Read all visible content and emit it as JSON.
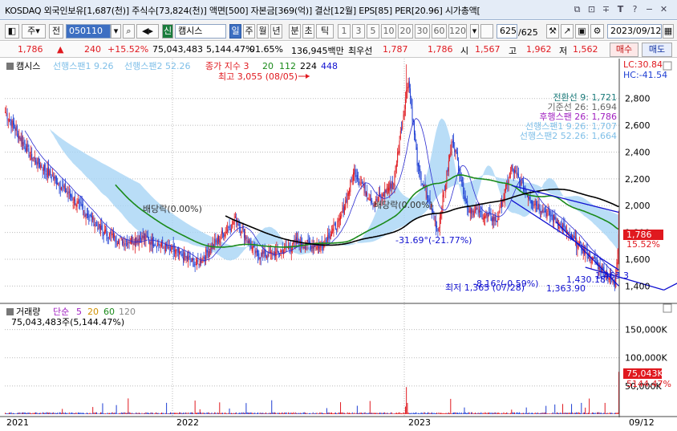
{
  "window": {
    "title": "KOSDAQ 외국인보유[1,687(천)] 주식수[73,824(천)] 액면[500] 자본금[369(억)] 결산[12월] EPS[85] PER[20.96] 시가총액["
  },
  "toolbar": {
    "code": "050110",
    "sh_badge": "신",
    "stock_name": "캠시스",
    "ju": "주",
    "jeon": "전",
    "periods": [
      "일",
      "주",
      "월",
      "년",
      "분",
      "초",
      "틱"
    ],
    "numbers": [
      "1",
      "3",
      "5",
      "10",
      "20",
      "30",
      "60",
      "120"
    ],
    "count": "625",
    "count_total": "/625",
    "date": "2023/09/12"
  },
  "quote": {
    "price": "1,786",
    "change": "240",
    "pct": "+15.52%",
    "volume": "75,043,483",
    "vol_pct": "5,144.47%",
    "turnover": "01.65%",
    "amount": "136,945백만",
    "best_ask_label": "최우선",
    "best_ask": "1,787",
    "best_bid": "1,786",
    "open_label": "시",
    "open": "1,567",
    "high_label": "고",
    "high": "1,962",
    "low_label": "저",
    "low": "1,562",
    "buy": "매수",
    "sell": "매도"
  },
  "price_panel": {
    "stock": "캠시스",
    "leg1": "선행스팬1 9.26",
    "leg2": "선행스팬2 52.26",
    "close_leg": "종가 지수 3",
    "periods": [
      "20",
      "112",
      "224",
      "448"
    ],
    "lc": "LC:30.84",
    "hc": "HC:-41.54",
    "high_note": "최고 3,055 (08/05)",
    "low_note": "최저 1,365 (07/28)",
    "low_value": "1,363.90",
    "trend_a": "1,430.18",
    "trend_b": "1,463.3",
    "angle1": "-31.69°(-21.77%)",
    "angle2": "-8.16°(-0.59%)",
    "dividend1": "배당락(0.00%)",
    "dividend2": "배당락(0.00%)",
    "ichimoku": [
      "전환선 9: 1,721",
      "기준선 26: 1,694",
      "후행스팬 26: 1,786",
      "선행스팬1 9.26: 1,707",
      "선행스팬2 52.26: 1,664"
    ],
    "price_tag": "1,786",
    "pct_tag": "15.52%"
  },
  "volume_panel": {
    "title": "거래량",
    "ma_label": "단순",
    "ma": [
      "5",
      "20",
      "60",
      "120"
    ],
    "value": "75,043,483주(5,144.47%)",
    "tag": "75,043K",
    "tag_pct": "5144.47%"
  },
  "x_axis": {
    "labels": [
      "2021",
      "2022",
      "2023",
      "09/12"
    ]
  },
  "colors": {
    "up": "#e0191f",
    "down": "#1e3fd3",
    "cloud": "#a8d4f5",
    "ma20": "#1a8a1a",
    "ma112": "#000000",
    "trend": "#1010d0"
  },
  "chart_data": {
    "type": "candlestick",
    "ylim": [
      1300,
      3050
    ],
    "yticks": [
      1400,
      1600,
      1800,
      2000,
      2200,
      2400,
      2600,
      2800
    ],
    "vol_ticks": [
      50000,
      100000,
      150000
    ],
    "vol_ylim": [
      0,
      175000
    ],
    "days": 625,
    "anchors": [
      [
        0,
        2700
      ],
      [
        25,
        2380
      ],
      [
        50,
        2200
      ],
      [
        75,
        2000
      ],
      [
        100,
        1800
      ],
      [
        120,
        1730
      ],
      [
        140,
        1760
      ],
      [
        175,
        1650
      ],
      [
        195,
        1560
      ],
      [
        215,
        1740
      ],
      [
        235,
        1900
      ],
      [
        255,
        1630
      ],
      [
        275,
        1640
      ],
      [
        295,
        1720
      ],
      [
        320,
        1700
      ],
      [
        340,
        1880
      ],
      [
        355,
        2260
      ],
      [
        375,
        2010
      ],
      [
        395,
        2180
      ],
      [
        410,
        2950
      ],
      [
        420,
        2260
      ],
      [
        440,
        1820
      ],
      [
        455,
        2500
      ],
      [
        470,
        1980
      ],
      [
        500,
        1890
      ],
      [
        515,
        2280
      ],
      [
        535,
        2040
      ],
      [
        560,
        1890
      ],
      [
        590,
        1650
      ],
      [
        620,
        1420
      ],
      [
        624,
        1786
      ]
    ],
    "spike_day": 408,
    "spike_high": 3055,
    "last_candle": {
      "open": 1567,
      "high": 1962,
      "low": 1562,
      "close": 1786
    }
  }
}
